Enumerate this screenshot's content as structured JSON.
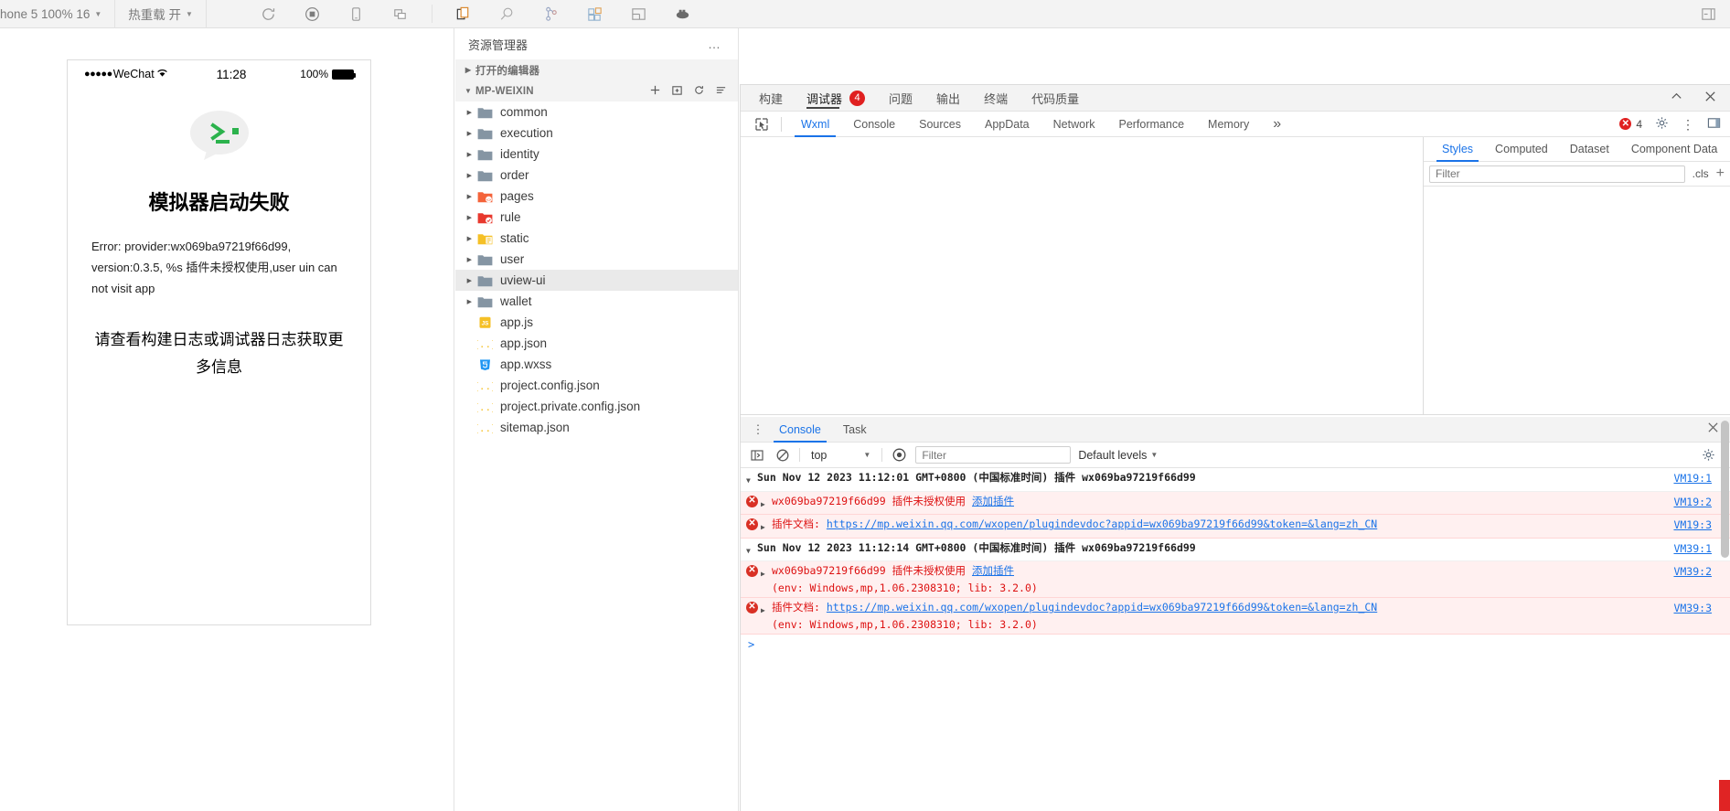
{
  "toolbar": {
    "device_label": "hone 5 100% 16",
    "hotreload_label": "热重载 开",
    "icons": [
      {
        "name": "refresh-icon",
        "glyph": "↻"
      },
      {
        "name": "stop-record-icon",
        "glyph": "◉"
      },
      {
        "name": "mobile-preview-icon",
        "glyph": "▭"
      },
      {
        "name": "multi-window-icon",
        "glyph": "❐"
      },
      {
        "name": "copy-page-icon",
        "glyph": "🗋"
      },
      {
        "name": "search-icon",
        "glyph": "🔍"
      },
      {
        "name": "source-control-icon",
        "glyph": "⑂"
      },
      {
        "name": "extensions-icon",
        "glyph": "▦"
      },
      {
        "name": "layout-icon",
        "glyph": "▤"
      },
      {
        "name": "docker-icon",
        "glyph": "🐳"
      }
    ],
    "right_icon": "⊣"
  },
  "simulator": {
    "status_bar": {
      "carrier": "WeChat",
      "dots": "●●●●●",
      "wifi": "≋",
      "time": "11:28",
      "battery_percent": "100%"
    },
    "error_title": "模拟器启动失败",
    "error_detail": "Error: provider:wx069ba97219f66d99, version:0.3.5, %s 插件未授权使用,user uin can not visit app",
    "error_hint": "请查看构建日志或调试器日志获取更多信息"
  },
  "explorer": {
    "title": "资源管理器",
    "more_label": "…",
    "sections": [
      {
        "name": "open-editors",
        "label": "打开的编辑器",
        "expanded": false
      },
      {
        "name": "project-root",
        "label": "MP-WEIXIN",
        "expanded": true
      }
    ],
    "section_actions": [
      "＋",
      "⊞",
      "↻",
      "⇳"
    ],
    "files": [
      {
        "label": "common",
        "type": "folder",
        "color": "#8595a3",
        "expandable": true,
        "selected": false
      },
      {
        "label": "execution",
        "type": "folder",
        "color": "#8595a3",
        "expandable": true,
        "selected": false
      },
      {
        "label": "identity",
        "type": "folder",
        "color": "#8595a3",
        "expandable": true,
        "selected": false
      },
      {
        "label": "order",
        "type": "folder",
        "color": "#8595a3",
        "expandable": true,
        "selected": false
      },
      {
        "label": "pages",
        "type": "folder",
        "color": "#f4633a",
        "expandable": true,
        "selected": false
      },
      {
        "label": "rule",
        "type": "folder",
        "color": "#e8392e",
        "expandable": true,
        "selected": false
      },
      {
        "label": "static",
        "type": "folder",
        "color": "#f5c026",
        "expandable": true,
        "selected": false
      },
      {
        "label": "user",
        "type": "folder",
        "color": "#8595a3",
        "expandable": true,
        "selected": false
      },
      {
        "label": "uview-ui",
        "type": "folder",
        "color": "#8595a3",
        "expandable": true,
        "selected": true
      },
      {
        "label": "wallet",
        "type": "folder",
        "color": "#8595a3",
        "expandable": true,
        "selected": false
      },
      {
        "label": "app.js",
        "type": "js",
        "color": "#f5c026",
        "expandable": false,
        "selected": false
      },
      {
        "label": "app.json",
        "type": "json",
        "color": "#f5c026",
        "expandable": false,
        "selected": false
      },
      {
        "label": "app.wxss",
        "type": "wxss",
        "color": "#2196f3",
        "expandable": false,
        "selected": false
      },
      {
        "label": "project.config.json",
        "type": "json",
        "color": "#f5c026",
        "expandable": false,
        "selected": false
      },
      {
        "label": "project.private.config.json",
        "type": "json",
        "color": "#f5c026",
        "expandable": false,
        "selected": false
      },
      {
        "label": "sitemap.json",
        "type": "json",
        "color": "#f5c026",
        "expandable": false,
        "selected": false
      }
    ]
  },
  "devtools": {
    "panel_tabs": [
      {
        "label": "构建",
        "active": false,
        "badge": null
      },
      {
        "label": "调试器",
        "active": true,
        "badge": "4"
      },
      {
        "label": "问题",
        "active": false,
        "badge": null
      },
      {
        "label": "输出",
        "active": false,
        "badge": null
      },
      {
        "label": "终端",
        "active": false,
        "badge": null
      },
      {
        "label": "代码质量",
        "active": false,
        "badge": null
      }
    ],
    "panel_collapse_icon": "⌃",
    "panel_close_icon": "✕",
    "inspector_tabs": [
      {
        "label": "Wxml",
        "active": true
      },
      {
        "label": "Console",
        "active": false
      },
      {
        "label": "Sources",
        "active": false
      },
      {
        "label": "AppData",
        "active": false
      },
      {
        "label": "Network",
        "active": false
      },
      {
        "label": "Performance",
        "active": false
      },
      {
        "label": "Memory",
        "active": false
      }
    ],
    "overflow_label": "»",
    "error_count": "4",
    "settings_icon": "⚙",
    "kebab_icon": "⋮",
    "dock_icon": "▣",
    "styles_tabs": [
      {
        "label": "Styles",
        "active": true
      },
      {
        "label": "Computed",
        "active": false
      },
      {
        "label": "Dataset",
        "active": false
      },
      {
        "label": "Component Data",
        "active": false
      }
    ],
    "styles_filter_placeholder": "Filter",
    "cls_label": ".cls",
    "plus_label": "+"
  },
  "console": {
    "tabs": [
      {
        "label": "Console",
        "active": true
      },
      {
        "label": "Task",
        "active": false
      }
    ],
    "close_icon": "✕",
    "context": "top",
    "filter_placeholder": "Filter",
    "levels_label": "Default levels",
    "settings_icon": "⚙",
    "prompt": ">",
    "entries": [
      {
        "kind": "group",
        "text": "Sun Nov 12 2023 11:12:01 GMT+0800 (中国标准时间) 插件  wx069ba97219f66d99",
        "source": "VM19:1"
      },
      {
        "kind": "error",
        "prefix": "wx069ba97219f66d99",
        "text": "插件未授权使用",
        "link": "添加插件",
        "source": "VM19:2"
      },
      {
        "kind": "error",
        "prefix": "插件文档:",
        "link_url": "https://mp.weixin.qq.com/wxopen/plugindevdoc?appid=wx069ba97219f66d99&token=&lang=zh_CN",
        "source": "VM19:3"
      },
      {
        "kind": "group",
        "text": "Sun Nov 12 2023 11:12:14 GMT+0800 (中国标准时间) 插件  wx069ba97219f66d99",
        "source": "VM39:1"
      },
      {
        "kind": "error",
        "prefix": "wx069ba97219f66d99",
        "text": "插件未授权使用",
        "link": "添加插件",
        "sub": "(env: Windows,mp,1.06.2308310; lib: 3.2.0)",
        "source": "VM39:2"
      },
      {
        "kind": "error",
        "prefix": "插件文档:",
        "link_url": "https://mp.weixin.qq.com/wxopen/plugindevdoc?appid=wx069ba97219f66d99&token=&lang=zh_CN",
        "sub": "(env: Windows,mp,1.06.2308310; lib: 3.2.0)",
        "source": "VM39:3"
      }
    ]
  },
  "colors": {
    "accent": "#1a73e8",
    "error": "#d93025",
    "badge": "#e02020",
    "toolbar_bg": "#f3f3f3"
  }
}
